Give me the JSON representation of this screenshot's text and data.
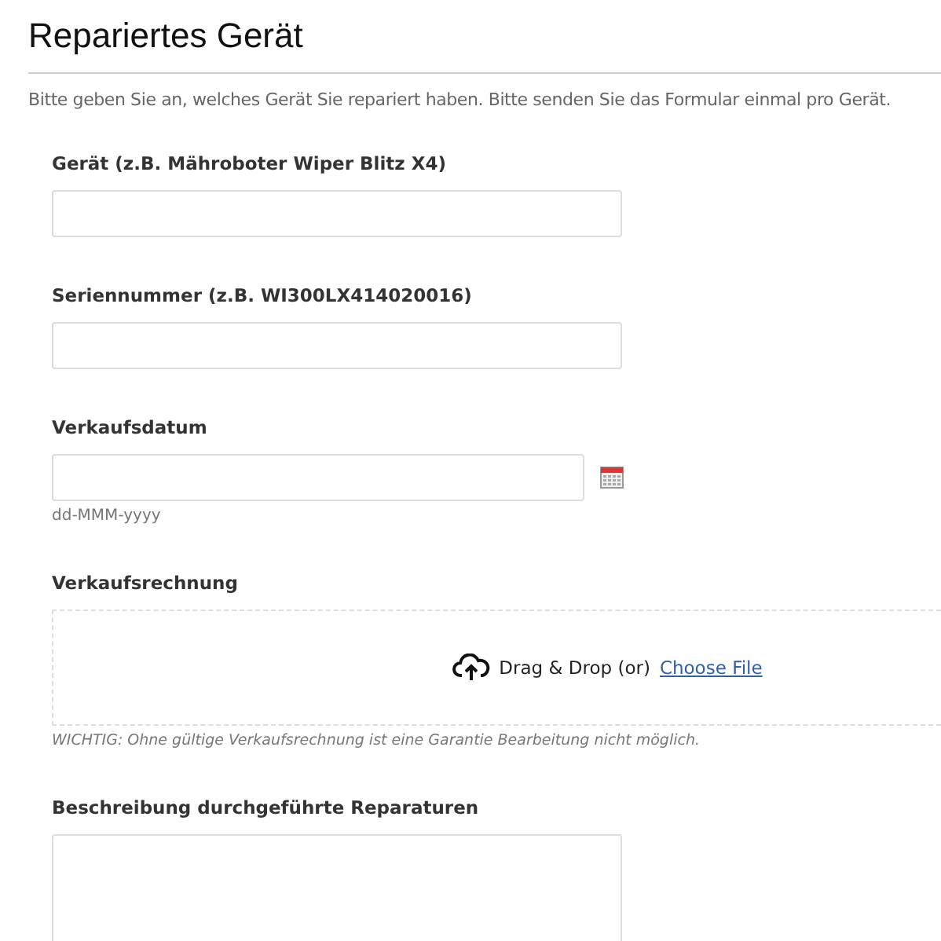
{
  "title": "Repariertes Gerät",
  "intro": "Bitte geben Sie an, welches Gerät Sie repariert haben. Bitte senden Sie das Formular einmal pro Gerät.",
  "fields": [
    {
      "kind": "text",
      "label": "Gerät (z.B. Mähroboter Wiper Blitz X4)"
    },
    {
      "kind": "text",
      "label": "Seriennummer (z.B. WI300LX414020016)"
    },
    {
      "kind": "date",
      "label": "Verkaufsdatum",
      "hint": "dd-MMM-yyyy"
    },
    {
      "kind": "upload",
      "label": "Verkaufsrechnung",
      "drop_text": "Drag & Drop (or)",
      "link": "Choose File",
      "note": "WICHTIG: Ohne gültige Verkaufsrechnung ist eine Garantie Bearbeitung nicht möglich."
    },
    {
      "kind": "textarea",
      "label": "Beschreibung durchgeführte Reparaturen"
    }
  ]
}
